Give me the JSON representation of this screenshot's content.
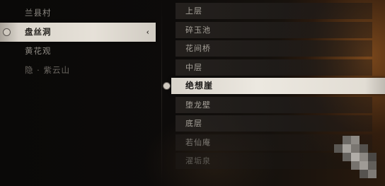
{
  "regions": [
    {
      "label": "兰县村",
      "state": "normal"
    },
    {
      "label": "盘丝洞",
      "state": "selected"
    },
    {
      "label": "黄花观",
      "state": "normal"
    },
    {
      "label": "隐 · 紫云山",
      "state": "dim"
    }
  ],
  "locations": [
    {
      "label": "上层"
    },
    {
      "label": "碎玉池"
    },
    {
      "label": "花间桥"
    },
    {
      "label": "中层"
    },
    {
      "label": "绝想崖"
    },
    {
      "label": "堕龙壁"
    },
    {
      "label": "底层"
    },
    {
      "label": "若仙庵"
    },
    {
      "label": "濯垢泉"
    }
  ],
  "icons": {
    "selected_marker": "circle-marker-icon",
    "selected_arrow": "chevron-left-icon",
    "arrow_glyph": "‹"
  },
  "colors": {
    "highlight": "#e6e1d8",
    "text": "#a8a39b",
    "background": "#0b0908",
    "glow": "#be6e28"
  }
}
